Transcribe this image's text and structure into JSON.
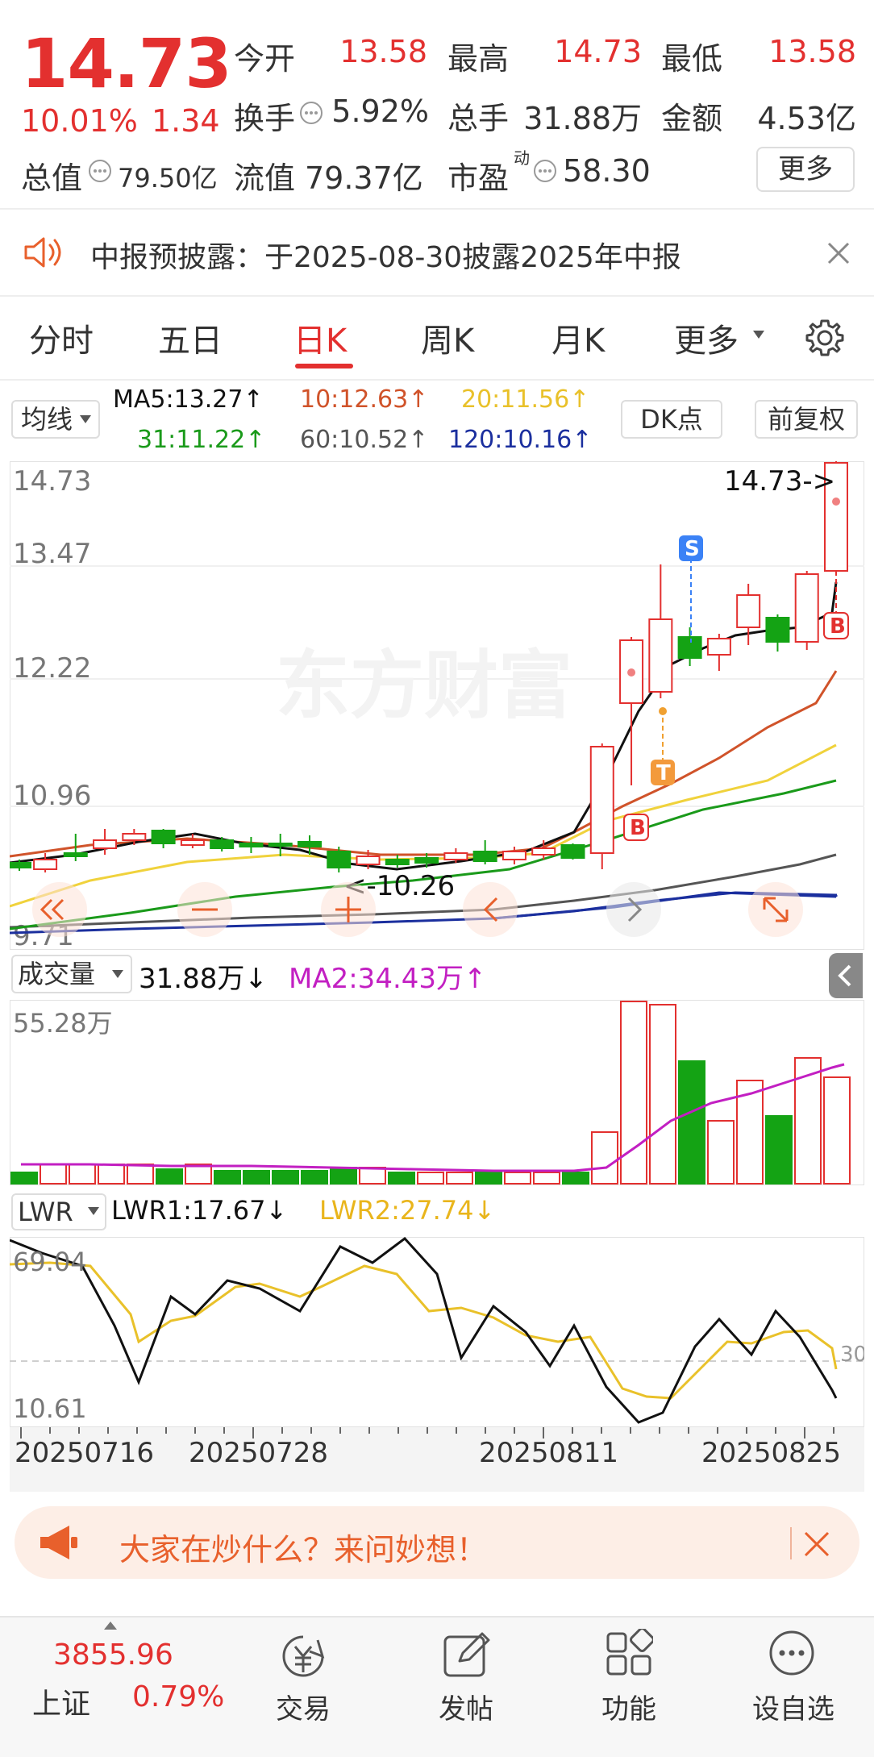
{
  "quote": {
    "price": "14.73",
    "change_pct": "10.01%",
    "change_abs": "1.34",
    "open_label": "今开",
    "open_value": "13.58",
    "high_label": "最高",
    "high_value": "14.73",
    "low_label": "最低",
    "low_value": "13.58",
    "turnover_label": "换手",
    "turnover_value": "5.92%",
    "volume_label": "总手",
    "volume_value": "31.88万",
    "amount_label": "金额",
    "amount_value": "4.53亿",
    "mcap_label": "总值",
    "mcap_value": "79.50亿",
    "float_label": "流值",
    "float_value": "79.37亿",
    "pe_label": "市盈",
    "pe_sup": "动",
    "pe_value": "58.30",
    "more_label": "更多"
  },
  "notice": {
    "text": "中报预披露：于2025-08-30披露2025年中报"
  },
  "tabs": [
    {
      "label": "分时"
    },
    {
      "label": "五日"
    },
    {
      "label": "日K"
    },
    {
      "label": "周K"
    },
    {
      "label": "月K"
    },
    {
      "label": "更多"
    }
  ],
  "ma_bar": {
    "selector": "均线",
    "ma5": "MA5:13.27↑",
    "ma10": "10:12.63↑",
    "ma20": "20:11.56↑",
    "ma31": "31:11.22↑",
    "ma60": "60:10.52↑",
    "ma120": "120:10.16↑",
    "dk_label": "DK点",
    "adjust_label": "前复权"
  },
  "kline": {
    "y_labels": [
      "14.73",
      "13.47",
      "12.22",
      "10.96",
      "9.71"
    ],
    "max_marker": "14.73->",
    "min_marker": "<-10.26",
    "watermark": "东方财富",
    "signal_s": "S",
    "signal_t": "T",
    "signal_b": "B"
  },
  "volume_bar": {
    "selector": "成交量",
    "value": "31.88万↓",
    "ma2": "MA2:34.43万↑",
    "max_label": "55.28万"
  },
  "lwr_bar": {
    "selector": "LWR",
    "lwr1": "LWR1:17.67↓",
    "lwr2": "LWR2:27.74↓",
    "top_label": "69.04",
    "bottom_label": "10.61",
    "ref_label": "30"
  },
  "dates": [
    "20250716",
    "20250728",
    "20250811",
    "20250825"
  ],
  "ad": {
    "text": "大家在炒什么？来问妙想！"
  },
  "bottom_nav": {
    "index_value": "3855.96",
    "index_name": "上证",
    "index_pct": "0.79%",
    "items": [
      {
        "label": "交易"
      },
      {
        "label": "发帖"
      },
      {
        "label": "功能"
      },
      {
        "label": "设自选"
      }
    ]
  },
  "colors": {
    "up": "#e3302f",
    "down": "#14a314",
    "ma5": "#111111",
    "ma10": "#d0532a",
    "ma20": "#f0d23c",
    "ma31": "#1a9a1a",
    "ma60": "#555555",
    "ma120": "#1b2f9e"
  }
}
